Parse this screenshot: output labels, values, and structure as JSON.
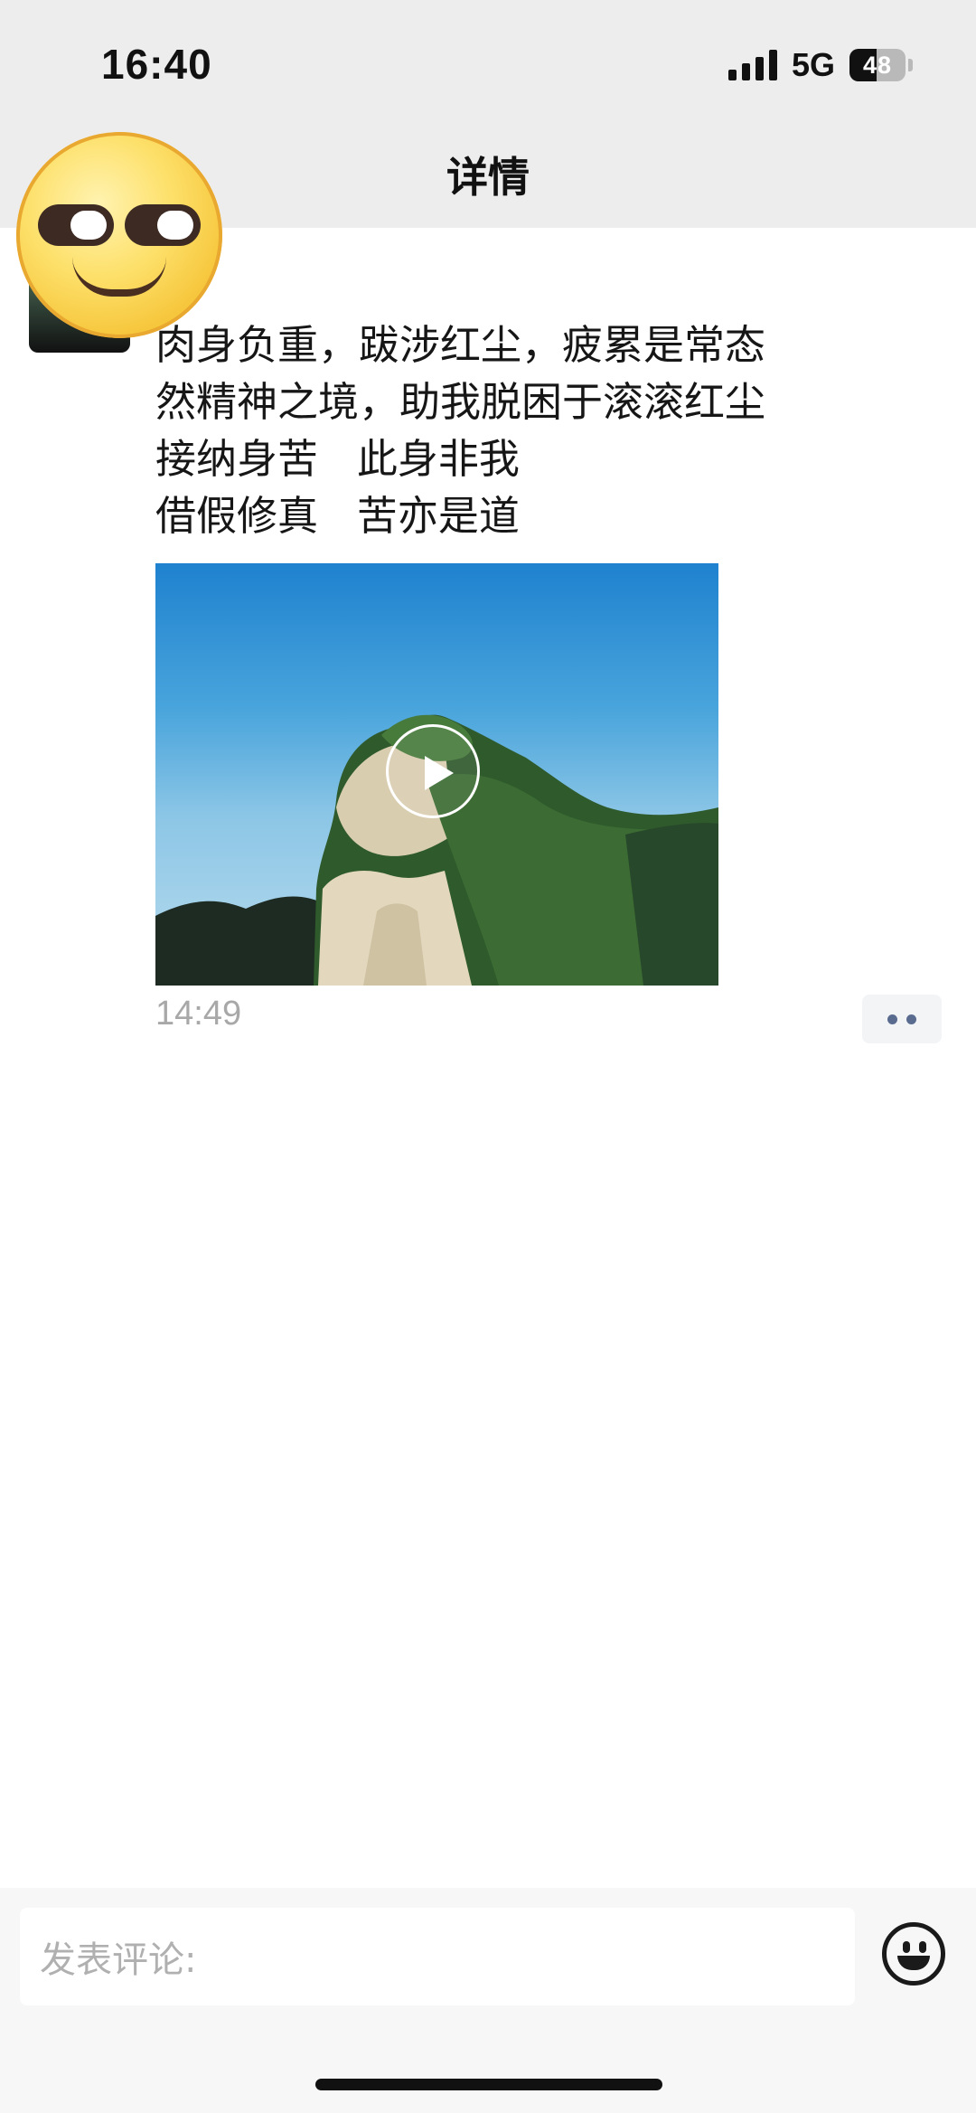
{
  "status_bar": {
    "time": "16:40",
    "network": "5G",
    "battery_level": "48",
    "battery_fraction": 0.48
  },
  "nav": {
    "title": "详情"
  },
  "post": {
    "lines": [
      "肉身负重，跋涉红尘，疲累是常态",
      "然精神之境，助我脱困于滚滚红尘",
      "接纳身苦   此身非我",
      "借假修真   苦亦是道"
    ],
    "time": "14:49"
  },
  "comment_bar": {
    "placeholder": "发表评论:"
  },
  "icons": {
    "overlay_emoji": "smirk-emoji-icon",
    "more": "more-dots-icon",
    "play": "play-icon",
    "emoji_button": "smiley-icon"
  },
  "colors": {
    "top_bar_bg": "#ededed",
    "timestamp": "#a8a8a8",
    "more_dots": "#5a6b90",
    "placeholder": "#b0b0b0"
  }
}
